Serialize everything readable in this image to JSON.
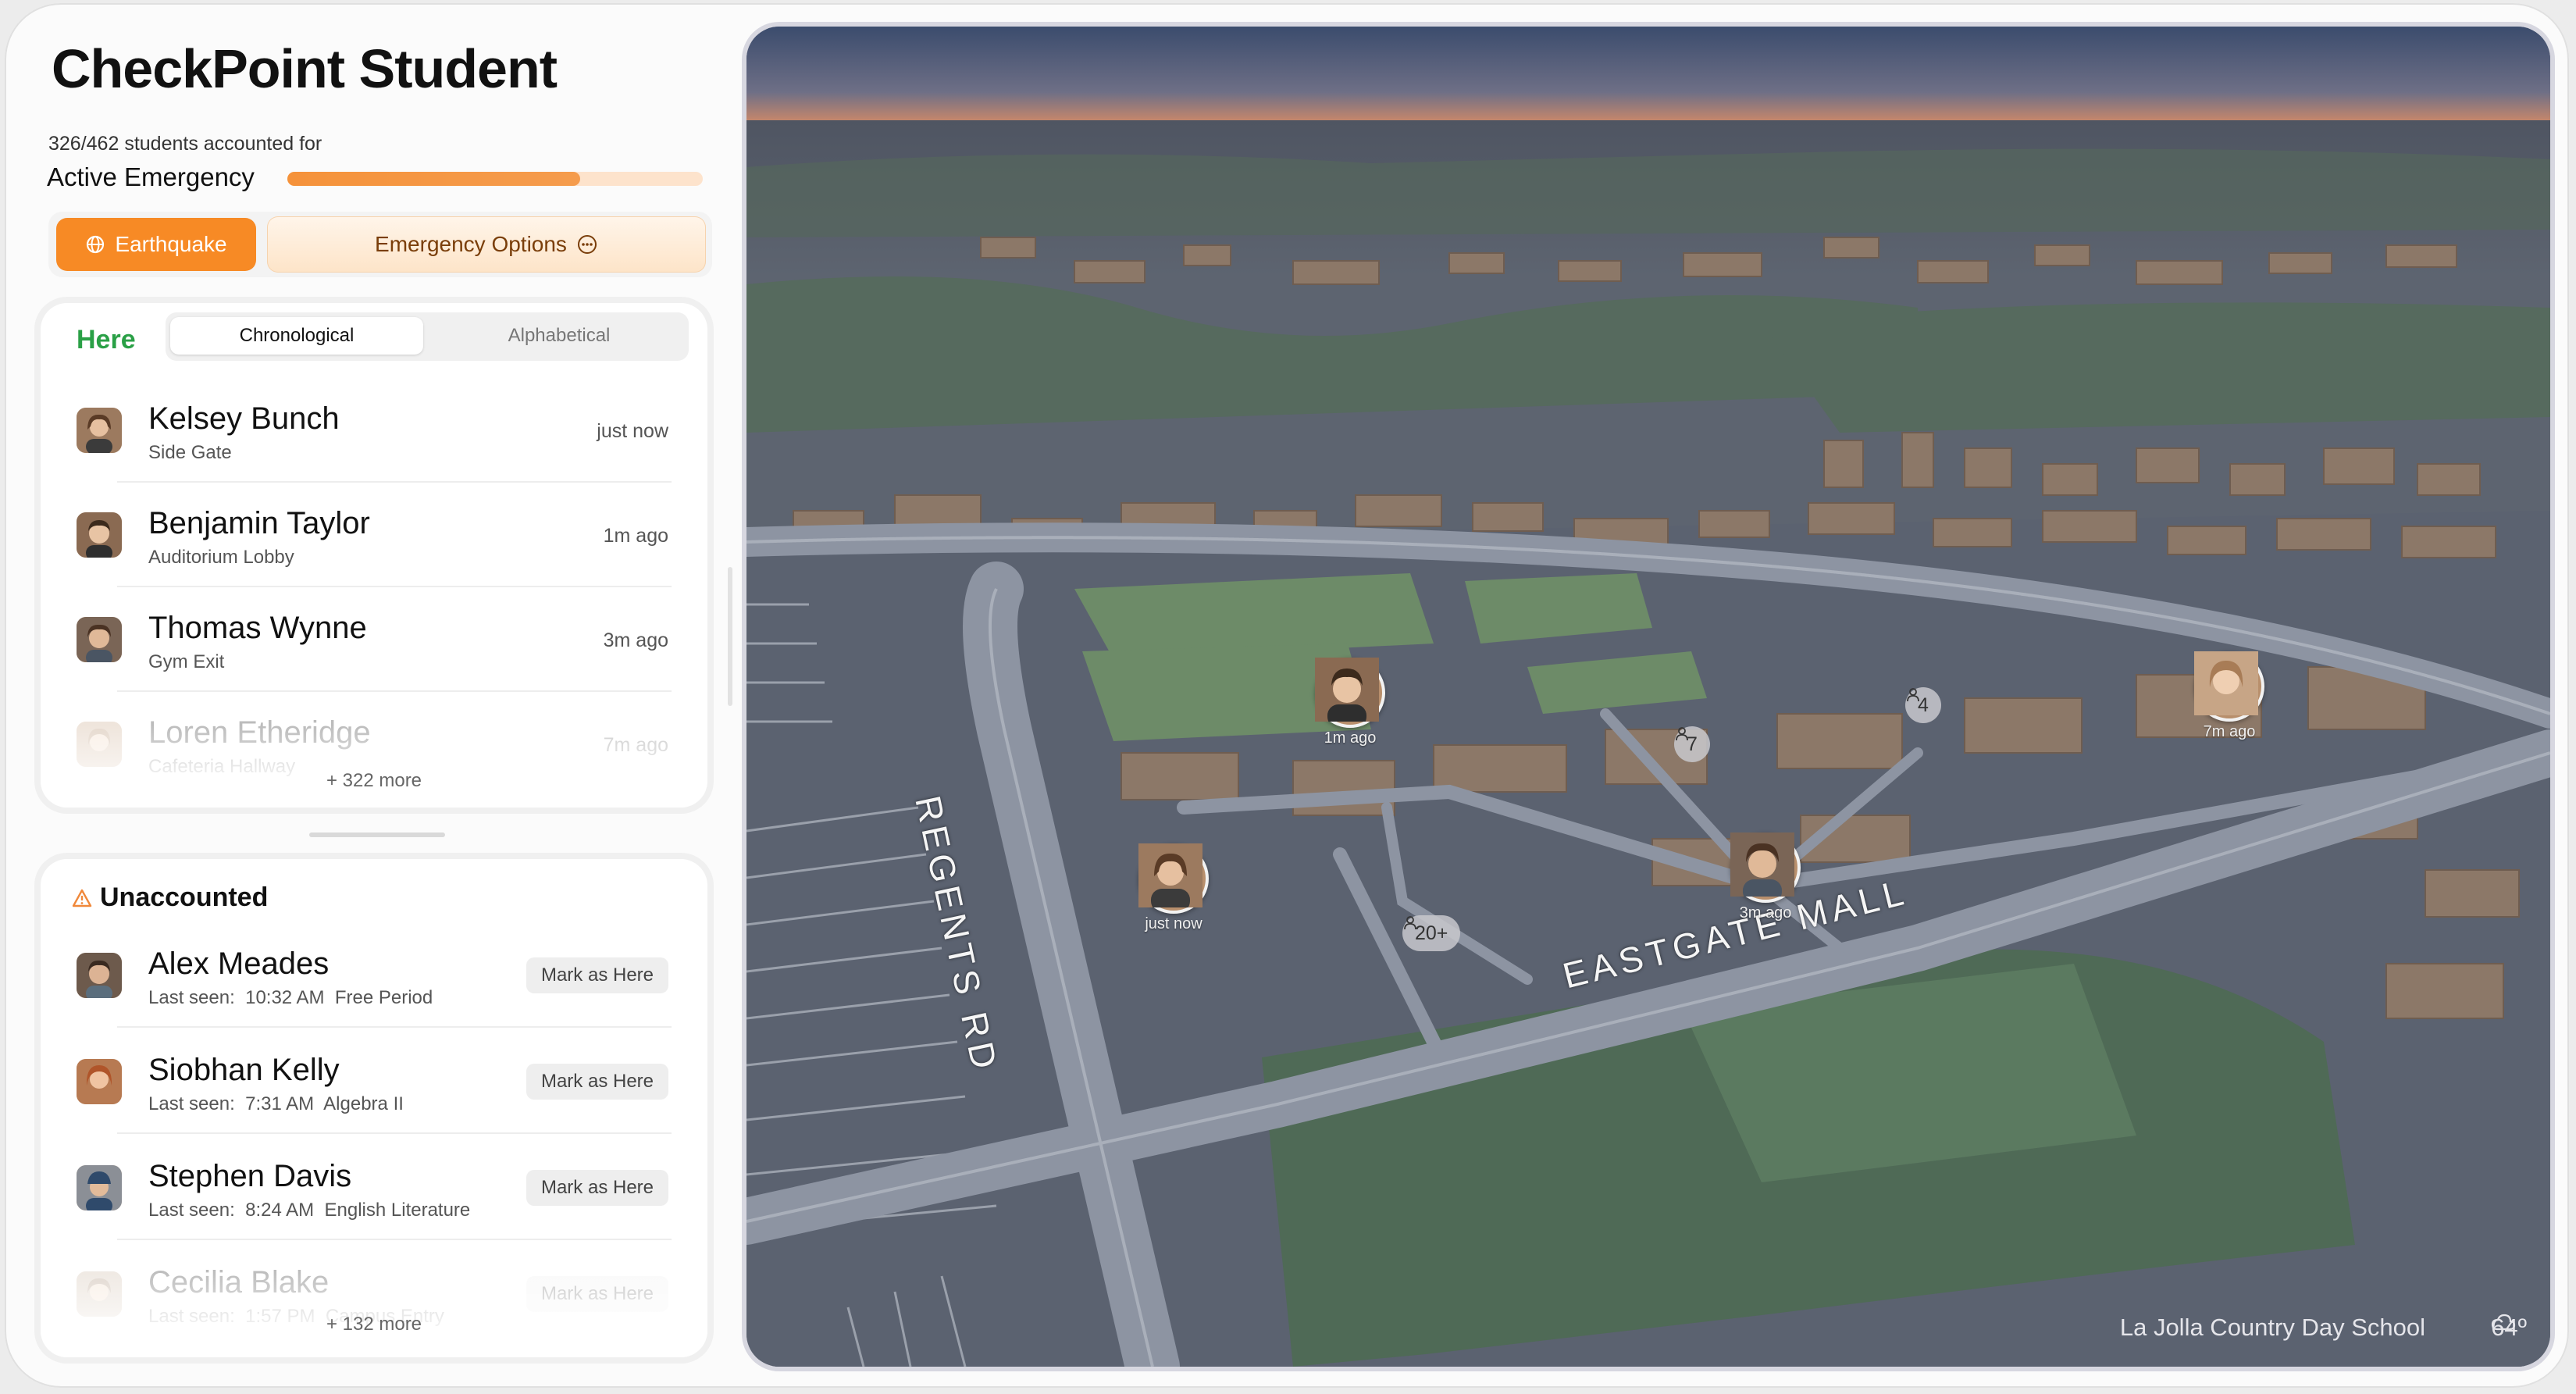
{
  "app": {
    "title": "CheckPoint Student",
    "count_text": "326/462 students accounted for",
    "status_label": "Active Emergency",
    "progress_fraction": 0.705
  },
  "buttons": {
    "emergency_type": "Earthquake",
    "emergency_options": "Emergency Options"
  },
  "here": {
    "title": "Here",
    "sort_tabs": [
      "Chronological",
      "Alphabetical"
    ],
    "selected_sort": "Chronological",
    "students": [
      {
        "name": "Kelsey Bunch",
        "location": "Side Gate",
        "time": "just now"
      },
      {
        "name": "Benjamin Taylor",
        "location": "Auditorium Lobby",
        "time": "1m ago"
      },
      {
        "name": "Thomas Wynne",
        "location": "Gym Exit",
        "time": "3m ago"
      },
      {
        "name": "Loren Etheridge",
        "location": "Cafeteria Hallway",
        "time": "7m ago"
      }
    ],
    "more": "+ 322 more"
  },
  "unaccounted": {
    "title": "Unaccounted",
    "mark_label": "Mark as Here",
    "students": [
      {
        "name": "Alex Meades",
        "last_seen": "Last seen:",
        "time": "10:32 AM",
        "class": "Free Period"
      },
      {
        "name": "Siobhan Kelly",
        "last_seen": "Last seen:",
        "time": "7:31 AM",
        "class": "Algebra II"
      },
      {
        "name": "Stephen Davis",
        "last_seen": "Last seen:",
        "time": "8:24 AM",
        "class": "English Literature"
      },
      {
        "name": "Cecilia Blake",
        "last_seen": "Last seen:",
        "time": "1:57 PM",
        "class": "Campus Entry"
      }
    ],
    "more": "+ 132 more"
  },
  "map": {
    "road_labels": [
      "REGENTS RD",
      "EASTGATE MALL"
    ],
    "markers": [
      {
        "label": "1m ago"
      },
      {
        "label": "just now"
      },
      {
        "label": "3m ago"
      },
      {
        "label": "7m ago"
      }
    ],
    "clusters": [
      "7",
      "4",
      "20+"
    ],
    "school": "La Jolla Country Day School",
    "weather": "64º",
    "icons": {
      "weather": "cloud-icon",
      "cluster": "person-icon"
    }
  },
  "colors": {
    "accent": "#f78a25",
    "here_green": "#2aa046"
  }
}
